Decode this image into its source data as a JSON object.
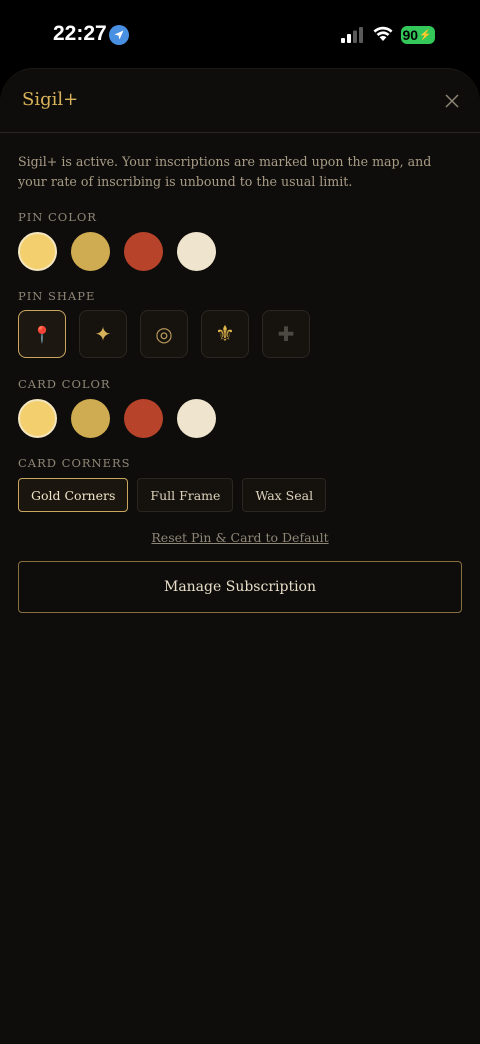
{
  "status_bar": {
    "time": "22:27",
    "battery": "90"
  },
  "sheet": {
    "title": "Sigil+",
    "description": "Sigil+ is active. Your inscriptions are marked upon the map, and your rate of inscribing is unbound to the usual limit.",
    "pin_color": {
      "label": "PIN COLOR",
      "options": [
        "#f4cf6d",
        "#cfac52",
        "#b8432b",
        "#efe5cf"
      ],
      "selected_index": 0
    },
    "pin_shape": {
      "label": "PIN SHAPE",
      "options": [
        "pushpin-icon",
        "sparkle-icon",
        "ring-icon",
        "fleur-de-lis-icon",
        "plus-icon"
      ],
      "glyphs": [
        "📍",
        "✦",
        "◎",
        "⚜",
        "✚"
      ],
      "selected_index": 0
    },
    "card_color": {
      "label": "CARD COLOR",
      "options": [
        "#f4cf6d",
        "#cfac52",
        "#b8432b",
        "#efe5cf"
      ],
      "selected_index": 0
    },
    "card_corners": {
      "label": "CARD CORNERS",
      "options": [
        "Gold Corners",
        "Full Frame",
        "Wax Seal"
      ],
      "selected_index": 0
    },
    "reset_label": "Reset Pin & Card to Default",
    "manage_label": "Manage Subscription"
  },
  "colors": {
    "accent": "#d8b25a",
    "background": "#0f0d0b"
  }
}
